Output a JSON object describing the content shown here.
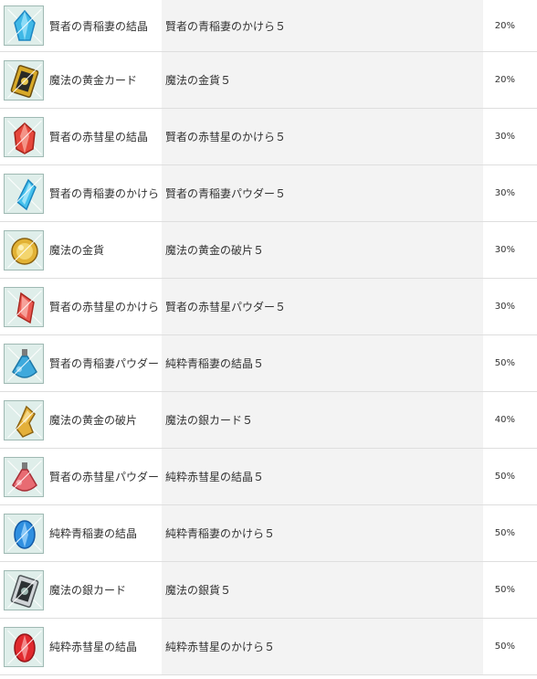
{
  "rows": [
    {
      "item": "賢者の青稲妻の結晶",
      "material": "賢者の青稲妻のかけら５",
      "rate": "20%",
      "icon": "blue-crystal-icon"
    },
    {
      "item": "魔法の黄金カード",
      "material": "魔法の金貨５",
      "rate": "20%",
      "icon": "gold-card-icon"
    },
    {
      "item": "賢者の赤彗星の結晶",
      "material": "賢者の赤彗星のかけら５",
      "rate": "30%",
      "icon": "red-crystal-icon"
    },
    {
      "item": "賢者の青稲妻のかけら",
      "material": "賢者の青稲妻パウダー５",
      "rate": "30%",
      "icon": "blue-shard-icon"
    },
    {
      "item": "魔法の金貨",
      "material": "魔法の黄金の破片５",
      "rate": "30%",
      "icon": "gold-coin-icon"
    },
    {
      "item": "賢者の赤彗星のかけら",
      "material": "賢者の赤彗星パウダー５",
      "rate": "30%",
      "icon": "red-shard-icon"
    },
    {
      "item": "賢者の青稲妻パウダー",
      "material": "純粋青稲妻の結晶５",
      "rate": "50%",
      "icon": "blue-powder-pouch-icon"
    },
    {
      "item": "魔法の黄金の破片",
      "material": "魔法の銀カード５",
      "rate": "40%",
      "icon": "gold-fragment-icon"
    },
    {
      "item": "賢者の赤彗星パウダー",
      "material": "純粋赤彗星の結晶５",
      "rate": "50%",
      "icon": "red-powder-pouch-icon"
    },
    {
      "item": "純粋青稲妻の結晶",
      "material": "純粋青稲妻のかけら５",
      "rate": "50%",
      "icon": "pure-blue-crystal-icon"
    },
    {
      "item": "魔法の銀カード",
      "material": "魔法の銀貨５",
      "rate": "50%",
      "icon": "silver-card-icon"
    },
    {
      "item": "純粋赤彗星の結晶",
      "material": "純粋赤彗星のかけら５",
      "rate": "50%",
      "icon": "pure-red-crystal-icon"
    }
  ]
}
